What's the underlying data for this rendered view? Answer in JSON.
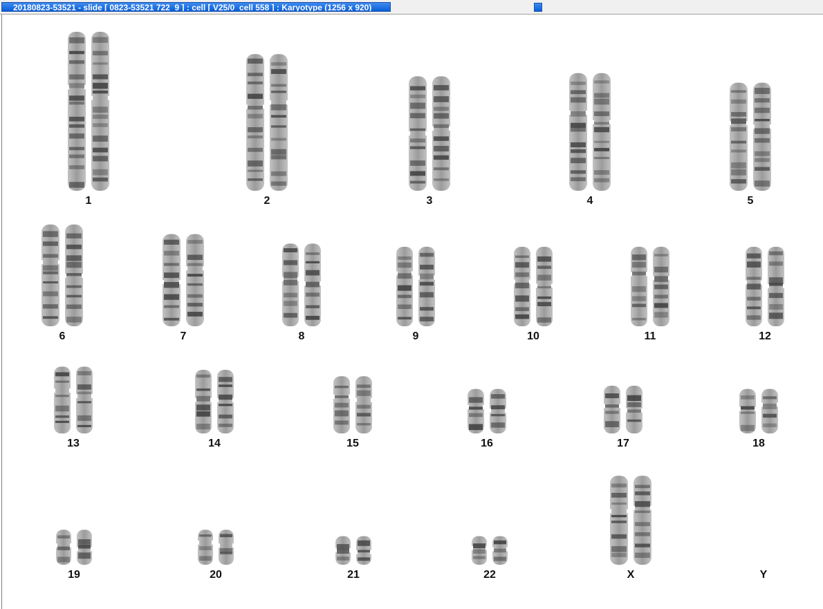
{
  "window": {
    "title": "20180823-53521 - slide [ 0823-53521 722_9 ] : cell [ V25/0_cell 558 ] : Karyotype  (1256 x 920)"
  },
  "colors": {
    "titlebar_accent": "#0a5fd8",
    "chromosome_dark": "#3a3a3a",
    "chromosome_light": "#c8c8c8"
  },
  "karyotype": {
    "chromosomes": [
      {
        "id": "1",
        "length": 1.0,
        "count": 2
      },
      {
        "id": "2",
        "length": 0.86,
        "count": 2
      },
      {
        "id": "3",
        "length": 0.72,
        "count": 2
      },
      {
        "id": "4",
        "length": 0.74,
        "count": 2
      },
      {
        "id": "5",
        "length": 0.68,
        "count": 2
      },
      {
        "id": "6",
        "length": 0.64,
        "count": 2
      },
      {
        "id": "7",
        "length": 0.58,
        "count": 2
      },
      {
        "id": "8",
        "length": 0.52,
        "count": 2
      },
      {
        "id": "9",
        "length": 0.5,
        "count": 2
      },
      {
        "id": "10",
        "length": 0.5,
        "count": 2
      },
      {
        "id": "11",
        "length": 0.5,
        "count": 2
      },
      {
        "id": "12",
        "length": 0.5,
        "count": 2
      },
      {
        "id": "13",
        "length": 0.42,
        "count": 2
      },
      {
        "id": "14",
        "length": 0.4,
        "count": 2
      },
      {
        "id": "15",
        "length": 0.36,
        "count": 2
      },
      {
        "id": "16",
        "length": 0.28,
        "count": 2
      },
      {
        "id": "17",
        "length": 0.3,
        "count": 2
      },
      {
        "id": "18",
        "length": 0.28,
        "count": 2
      },
      {
        "id": "19",
        "length": 0.22,
        "count": 2
      },
      {
        "id": "20",
        "length": 0.22,
        "count": 2
      },
      {
        "id": "21",
        "length": 0.18,
        "count": 2
      },
      {
        "id": "22",
        "length": 0.18,
        "count": 2
      },
      {
        "id": "X",
        "length": 0.56,
        "count": 2
      },
      {
        "id": "Y",
        "length": 0.0,
        "count": 0
      }
    ]
  }
}
